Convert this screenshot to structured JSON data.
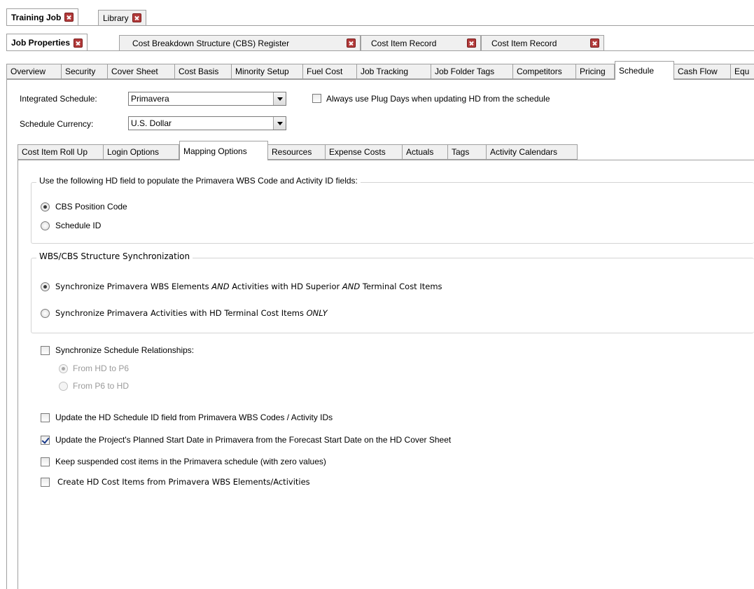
{
  "doc_tabs_row1": [
    {
      "label": "Training Job",
      "active": true
    },
    {
      "label": "Library",
      "active": false
    }
  ],
  "doc_tabs_row2": [
    {
      "label": "Job Properties",
      "active": true
    },
    {
      "label": "Cost Breakdown Structure (CBS) Register",
      "active": false
    },
    {
      "label": "Cost Item Record",
      "active": false
    },
    {
      "label": "Cost Item Record",
      "active": false
    }
  ],
  "property_tabs": [
    "Overview",
    "Security",
    "Cover Sheet",
    "Cost Basis",
    "Minority Setup",
    "Fuel Cost",
    "Job Tracking",
    "Job Folder Tags",
    "Competitors",
    "Pricing",
    "Schedule",
    "Cash Flow",
    "Equ"
  ],
  "active_property_tab": "Schedule",
  "integrated_schedule": {
    "label": "Integrated Schedule:",
    "value": "Primavera"
  },
  "schedule_currency": {
    "label": "Schedule Currency:",
    "value": "U.S. Dollar"
  },
  "plug_days": {
    "label": "Always use Plug Days when updating HD from the schedule",
    "checked": false
  },
  "sub_tabs": [
    "Cost Item Roll Up",
    "Login Options",
    "Mapping Options",
    "Resources",
    "Expense Costs",
    "Actuals",
    "Tags",
    "Activity Calendars"
  ],
  "active_sub_tab": "Mapping Options",
  "field_group": {
    "legend": "Use the following HD field to populate the Primavera WBS Code and Activity ID fields:",
    "options": [
      {
        "label": "CBS Position Code",
        "selected": true
      },
      {
        "label": "Schedule ID",
        "selected": false
      }
    ]
  },
  "sync_group": {
    "legend": "WBS/CBS Structure Synchronization",
    "option1": {
      "pre": "Synchronize Primavera WBS Elements ",
      "em1": "AND",
      "mid": " Activities with HD Superior ",
      "em2": "AND",
      "post": " Terminal Cost Items",
      "selected": true
    },
    "option2": {
      "pre": "Synchronize Primavera Activities with HD Terminal Cost Items ",
      "em": "ONLY",
      "selected": false
    }
  },
  "relationships": {
    "label": "Synchronize Schedule Relationships:",
    "checked": false,
    "options": [
      {
        "label": "From HD to P6",
        "selected": true
      },
      {
        "label": "From P6 to HD",
        "selected": false
      }
    ]
  },
  "checkboxes": [
    {
      "label": "Update the HD Schedule ID field from Primavera WBS Codes / Activity IDs",
      "checked": false
    },
    {
      "label": "Update the Project's Planned Start Date in Primavera from the Forecast Start Date on the HD Cover Sheet",
      "checked": true
    },
    {
      "label": "Keep suspended cost items in the Primavera schedule (with zero values)",
      "checked": false
    },
    {
      "label": "Create HD Cost Items from Primavera WBS Elements/Activities",
      "checked": false
    }
  ]
}
